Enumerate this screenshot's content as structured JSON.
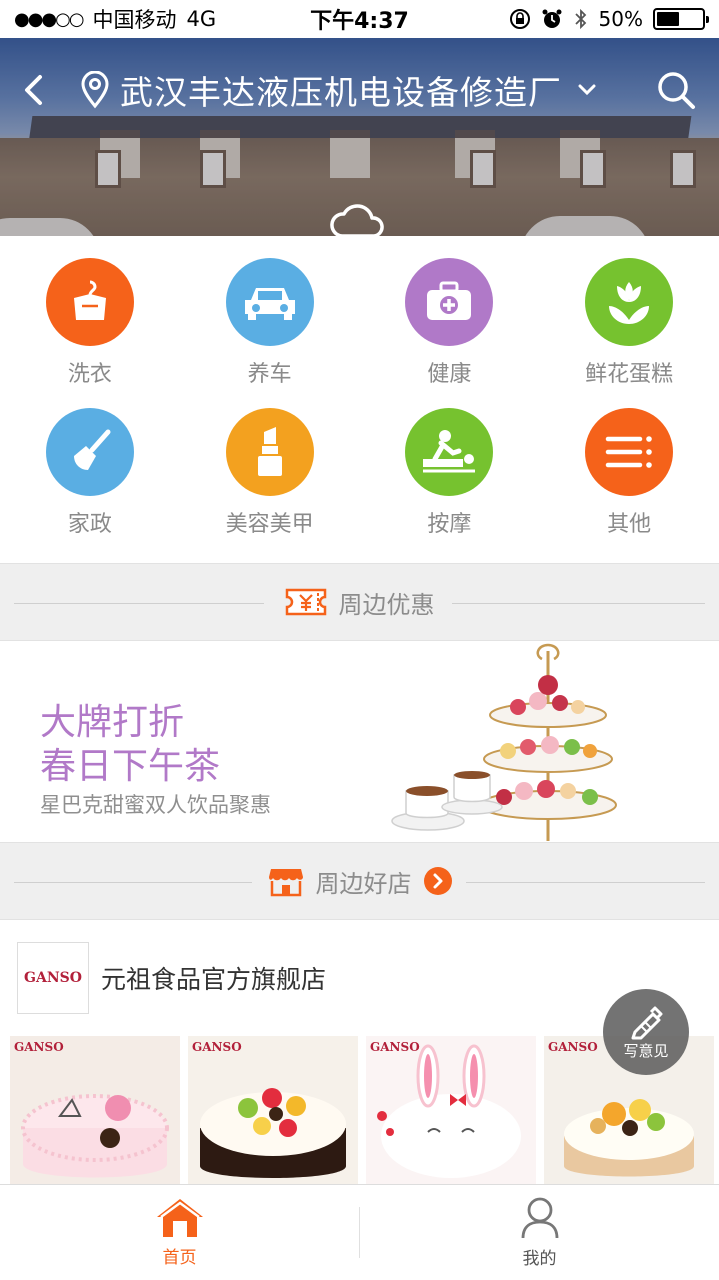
{
  "status_bar": {
    "carrier": "中国移动",
    "network": "4G",
    "time": "下午4:37",
    "battery_percent": "50%",
    "battery_level": 0.5
  },
  "header": {
    "location": "武汉丰达液压机电设备修造厂",
    "icons": [
      "back-icon",
      "location-pin-icon",
      "chevron-down-icon",
      "search-icon",
      "cloud-rain-icon"
    ]
  },
  "categories": [
    {
      "label": "洗衣",
      "icon": "laundry-icon",
      "color": "#f5621a"
    },
    {
      "label": "养车",
      "icon": "car-icon",
      "color": "#5aaee3"
    },
    {
      "label": "健康",
      "icon": "medical-kit-icon",
      "color": "#b079c8"
    },
    {
      "label": "鲜花蛋糕",
      "icon": "flower-icon",
      "color": "#76c22f"
    },
    {
      "label": "家政",
      "icon": "broom-icon",
      "color": "#5aaee3"
    },
    {
      "label": "美容美甲",
      "icon": "lipstick-icon",
      "color": "#f3a11f"
    },
    {
      "label": "按摩",
      "icon": "massage-icon",
      "color": "#76c22f"
    },
    {
      "label": "其他",
      "icon": "more-list-icon",
      "color": "#f5621a"
    }
  ],
  "deals_section": {
    "title": "周边优惠",
    "icon": "coupon-icon"
  },
  "promo": {
    "title_line1": "大牌打折",
    "title_line2": "春日下午茶",
    "subtitle": "星巴克甜蜜双人饮品聚惠"
  },
  "shops_section": {
    "title": "周边好店",
    "icon": "shop-icon"
  },
  "shop": {
    "logo_text": "GANSO",
    "name": "元祖食品官方旗舰店",
    "products": [
      {
        "brand": "GANSO"
      },
      {
        "brand": "GANSO"
      },
      {
        "brand": "GANSO"
      },
      {
        "brand": "GANSO"
      }
    ]
  },
  "feedback": {
    "label": "写意见"
  },
  "tabbar": {
    "home": "首页",
    "mine": "我的"
  },
  "colors": {
    "accent": "#f5621a",
    "tab_active": "#f5621a",
    "tab_inactive": "#555555"
  }
}
